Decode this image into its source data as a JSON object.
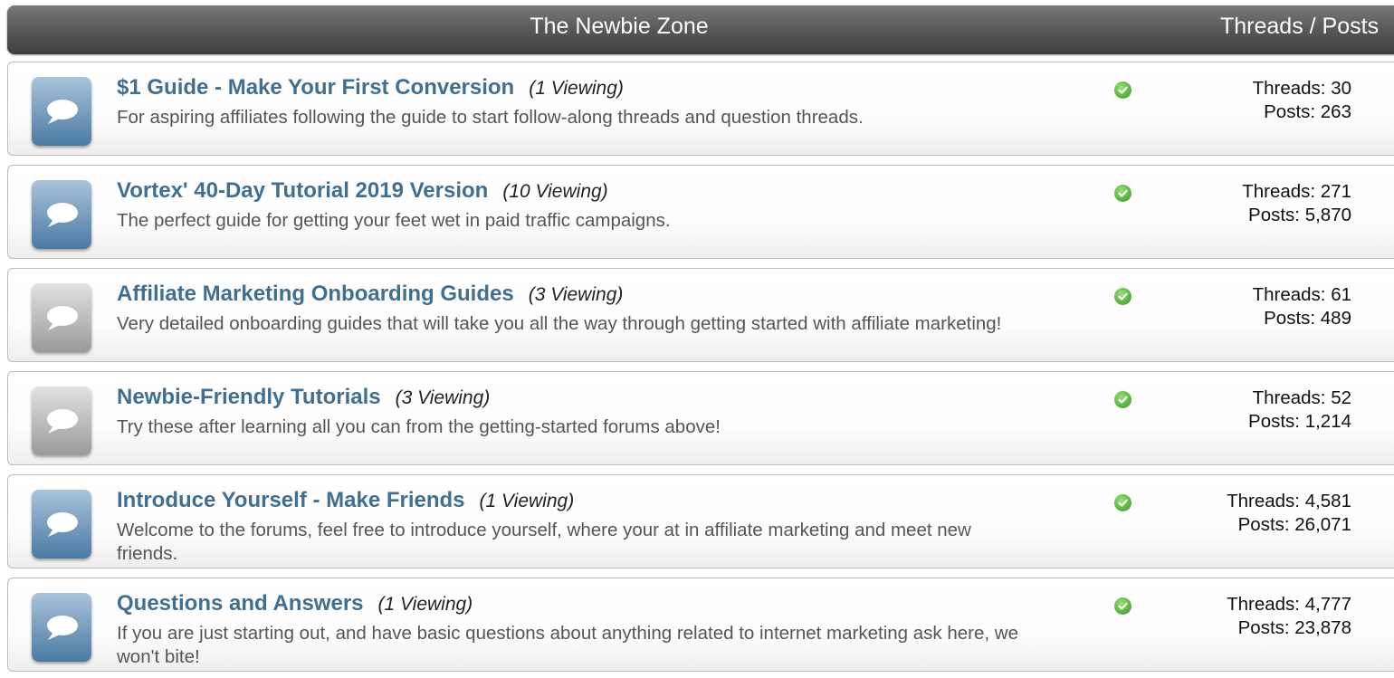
{
  "header": {
    "title": "The Newbie Zone",
    "stats_label": "Threads / Posts"
  },
  "forums": [
    {
      "title": "$1 Guide - Make Your First Conversion",
      "viewing": "(1 Viewing)",
      "description": "For aspiring affiliates following the guide to start follow-along threads and question threads.",
      "threads": "Threads: 30",
      "posts": "Posts: 263",
      "icon": "speech-bubble-icon-blue"
    },
    {
      "title": "Vortex' 40-Day Tutorial 2019 Version",
      "viewing": "(10 Viewing)",
      "description": "The perfect guide for getting your feet wet in paid traffic campaigns.",
      "threads": "Threads: 271",
      "posts": "Posts: 5,870",
      "icon": "speech-bubble-icon-blue"
    },
    {
      "title": "Affiliate Marketing Onboarding Guides",
      "viewing": "(3 Viewing)",
      "description": "Very detailed onboarding guides that will take you all the way through getting started with affiliate marketing!",
      "threads": "Threads: 61",
      "posts": "Posts: 489",
      "icon": "speech-bubble-icon-gray"
    },
    {
      "title": "Newbie-Friendly Tutorials",
      "viewing": "(3 Viewing)",
      "description": "Try these after learning all you can from the getting-started forums above!",
      "threads": "Threads: 52",
      "posts": "Posts: 1,214",
      "icon": "speech-bubble-icon-gray"
    },
    {
      "title": "Introduce Yourself - Make Friends",
      "viewing": "(1 Viewing)",
      "description": "Welcome to the forums, feel free to introduce yourself, where your at in affiliate marketing and meet new friends.",
      "threads": "Threads: 4,581",
      "posts": "Posts: 26,071",
      "icon": "speech-bubble-icon-blue"
    },
    {
      "title": "Questions and Answers",
      "viewing": "(1 Viewing)",
      "description": "If you are just starting out, and have basic questions about anything related to internet marketing ask here, we won't bite!",
      "threads": "Threads: 4,777",
      "posts": "Posts: 23,878",
      "icon": "speech-bubble-icon-blue"
    }
  ],
  "colors": {
    "title_link": "#3f6f92",
    "icon_blue_top": "#a9c3dc",
    "icon_blue_bottom": "#4a7aa3",
    "icon_gray_top": "#e2e2e2",
    "icon_gray_bottom": "#9a9a9a",
    "status_green": "#5cb842"
  }
}
